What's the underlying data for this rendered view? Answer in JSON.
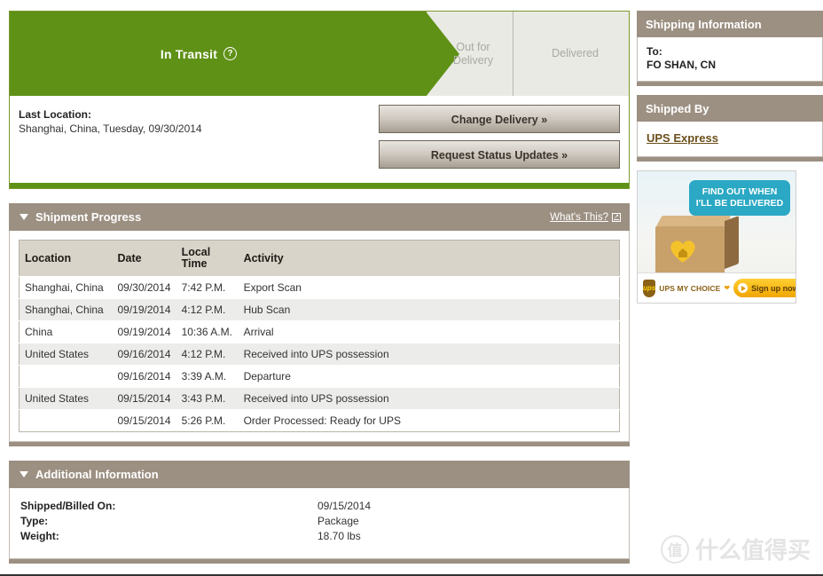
{
  "progress": {
    "stages": [
      {
        "label": "In Transit",
        "state": "active",
        "help_icon": "question-mark-circle-icon"
      },
      {
        "label_line1": "Out for",
        "label_line2": "Delivery",
        "state": "inactive"
      },
      {
        "label": "Delivered",
        "state": "inactive"
      }
    ],
    "active_color": "#5f9116",
    "inactive_color": "#eaeae4"
  },
  "status_detail": {
    "last_location_label": "Last Location:",
    "last_location_value": "Shanghai, China, Tuesday, 09/30/2014",
    "buttons": [
      {
        "label": "Change Delivery »"
      },
      {
        "label": "Request Status Updates »"
      }
    ]
  },
  "shipment_progress": {
    "title": "Shipment Progress",
    "whats_this_label": "What's This?",
    "whats_this_icon": "external-link-icon",
    "caret_icon": "caret-down-icon",
    "columns": [
      "Location",
      "Date",
      "Local\nTime",
      "Activity"
    ],
    "column_local_time_line1": "Local",
    "column_local_time_line2": "Time",
    "rows": [
      {
        "location": "Shanghai, China",
        "date": "09/30/2014",
        "time": "7:42 P.M.",
        "activity": "Export Scan"
      },
      {
        "location": "Shanghai, China",
        "date": "09/19/2014",
        "time": "4:12 P.M.",
        "activity": "Hub Scan"
      },
      {
        "location": "China",
        "date": "09/19/2014",
        "time": "10:36 A.M.",
        "activity": "Arrival"
      },
      {
        "location": "United States",
        "date": "09/16/2014",
        "time": "4:12 P.M.",
        "activity": "Received into UPS possession"
      },
      {
        "location": "",
        "date": "09/16/2014",
        "time": "3:39 A.M.",
        "activity": "Departure"
      },
      {
        "location": "United States",
        "date": "09/15/2014",
        "time": "3:43 P.M.",
        "activity": "Received into UPS possession"
      },
      {
        "location": "",
        "date": "09/15/2014",
        "time": "5:26 P.M.",
        "activity": "Order Processed: Ready for UPS"
      }
    ]
  },
  "additional_information": {
    "title": "Additional Information",
    "caret_icon": "caret-down-icon",
    "rows": [
      {
        "label": "Shipped/Billed On:",
        "value": "09/15/2014"
      },
      {
        "label": "Type:",
        "value": "Package"
      },
      {
        "label": "Weight:",
        "value": "18.70 lbs"
      }
    ]
  },
  "sidebar": {
    "shipping_information": {
      "title": "Shipping Information",
      "to_label": "To:",
      "to_value": "FO SHAN, CN"
    },
    "shipped_by": {
      "title": "Shipped By",
      "carrier": "UPS Express"
    },
    "ad": {
      "bubble_line1": "FIND OUT WHEN",
      "bubble_line2": "I'LL BE DELIVERED",
      "brand_mark": "ups-shield-icon",
      "brand_text": "ups",
      "program_name": "UPS MY CHOICE",
      "heart_icon": "heart-icon",
      "cta_label": "Sign up now",
      "cta_icon": "play-triangle-icon",
      "box_icon": "cardboard-box-icon"
    }
  },
  "watermark": {
    "logo_char": "值",
    "text": "什么值得买"
  }
}
